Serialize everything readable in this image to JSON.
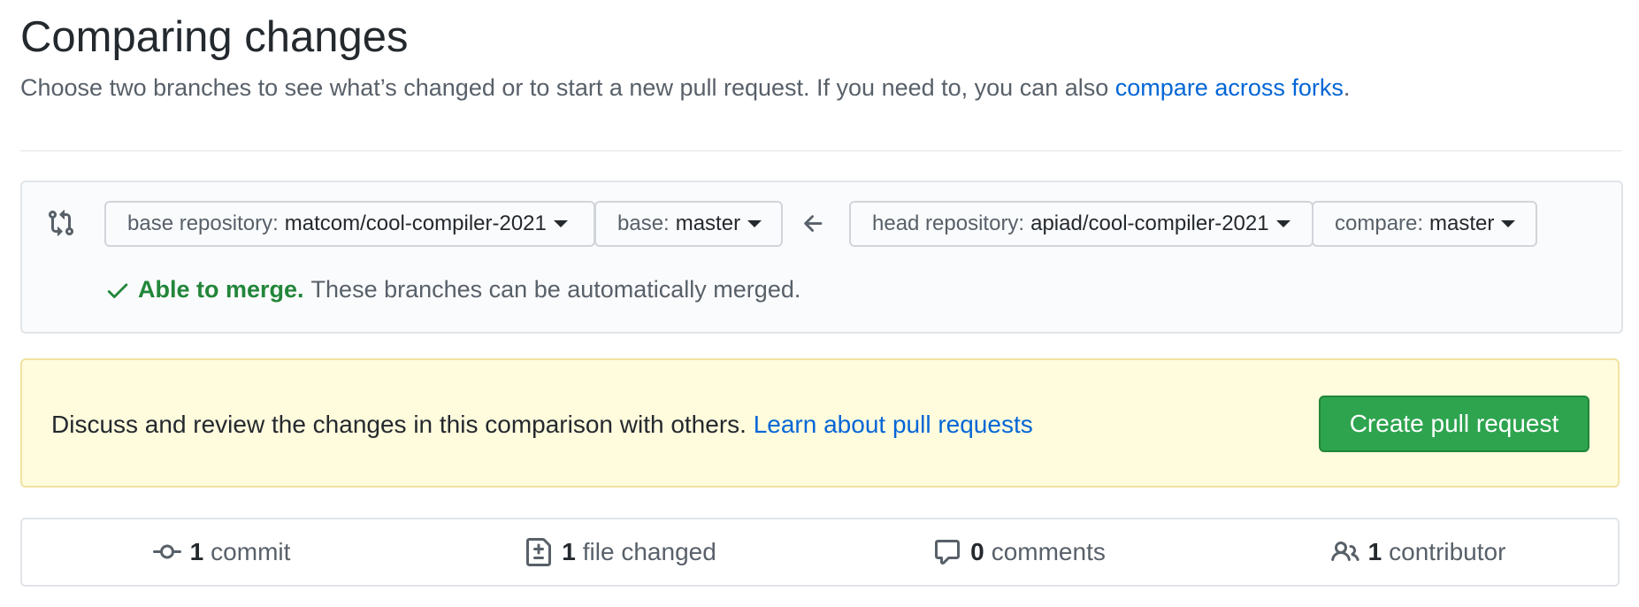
{
  "header": {
    "title": "Comparing changes",
    "subtitle_text": "Choose two branches to see what’s changed or to start a new pull request. If you need to, you can also",
    "subtitle_link": "compare across forks",
    "subtitle_end": "."
  },
  "range": {
    "base_repo_label": "base repository:",
    "base_repo_value": "matcom/cool-compiler-2021",
    "base_label": "base:",
    "base_value": "master",
    "head_repo_label": "head repository:",
    "head_repo_value": "apiad/cool-compiler-2021",
    "compare_label": "compare:",
    "compare_value": "master",
    "merge_status_strong": "Able to merge.",
    "merge_status_text": "These branches can be automatically merged."
  },
  "flash": {
    "text": "Discuss and review the changes in this comparison with others.",
    "link": "Learn about pull requests",
    "button": "Create pull request"
  },
  "stats": {
    "commits_num": "1",
    "commits_label": "commit",
    "files_num": "1",
    "files_label": "file changed",
    "comments_num": "0",
    "comments_label": "comments",
    "contributors_num": "1",
    "contributors_label": "contributor"
  },
  "colors": {
    "link": "#0366d6",
    "success": "#22863a",
    "primary_button": "#2ea44f",
    "flash_bg": "#fffbdd"
  },
  "icons": [
    "git-compare-icon",
    "arrow-left-icon",
    "check-icon",
    "git-commit-icon",
    "file-diff-icon",
    "comment-icon",
    "people-icon"
  ]
}
